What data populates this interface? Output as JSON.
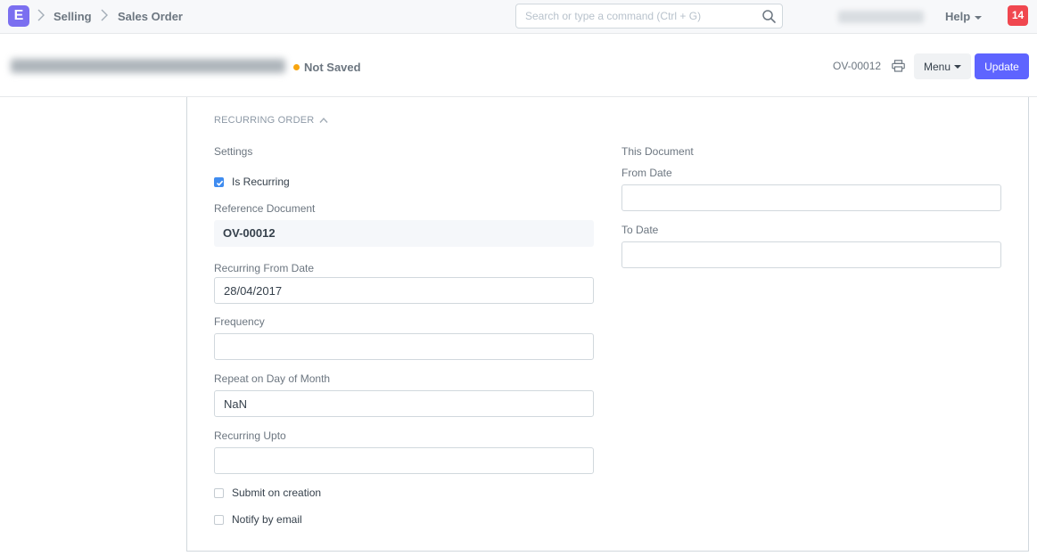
{
  "navbar": {
    "logo_letter": "E",
    "breadcrumbs": [
      "Selling",
      "Sales Order"
    ],
    "search_placeholder": "Search or type a command (Ctrl + G)",
    "help_label": "Help",
    "notification_count": "14"
  },
  "page_head": {
    "status": "Not Saved",
    "status_color": "#f8a50f",
    "doc_name": "OV-00012",
    "menu_label": "Menu",
    "update_label": "Update",
    "primary_color": "#5e64ff"
  },
  "section": {
    "title": "RECURRING ORDER",
    "left": {
      "group_label": "Settings",
      "is_recurring_label": "Is Recurring",
      "is_recurring_checked": true,
      "reference_document_label": "Reference Document",
      "reference_document_value": "OV-00012",
      "recurring_from_date_label": "Recurring From Date",
      "recurring_from_date_value": "28/04/2017",
      "frequency_label": "Frequency",
      "frequency_value": "",
      "repeat_on_day_label": "Repeat on Day of Month",
      "repeat_on_day_value": "NaN",
      "recurring_upto_label": "Recurring Upto",
      "recurring_upto_value": "",
      "submit_on_creation_label": "Submit on creation",
      "notify_by_email_label": "Notify by email"
    },
    "right": {
      "group_label": "This Document",
      "from_date_label": "From Date",
      "from_date_value": "",
      "to_date_label": "To Date",
      "to_date_value": ""
    }
  }
}
